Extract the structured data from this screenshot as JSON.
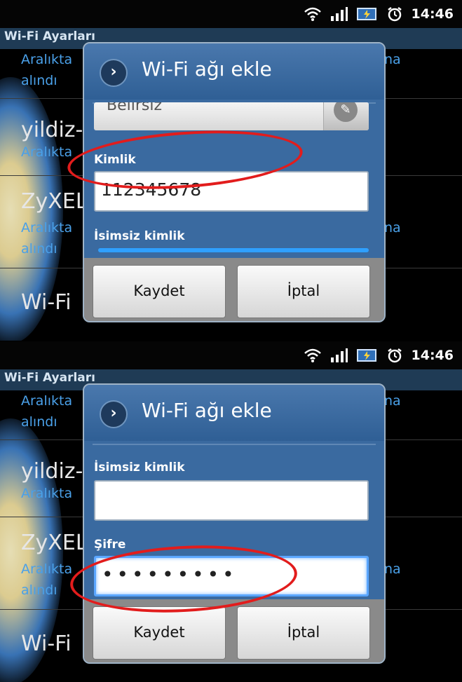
{
  "status_bar": {
    "time": "14:46",
    "icons": [
      "wifi-icon",
      "signal-icon",
      "battery-icon",
      "alarm-icon"
    ]
  },
  "app": {
    "title": "Wi-Fi Ayarları"
  },
  "background_list": {
    "item1_sub": "Aralıkta",
    "item1_sub2": "alındı",
    "item1_sub_suffix": "na",
    "item2_name": "yildiz-",
    "item2_sub": "Aralıkta",
    "item3_name": "ZyXEL",
    "item3_sub": "Aralıkta",
    "item3_sub2": "alındı",
    "item3_sub_suffix": "na",
    "item4_name": "Wi-Fi"
  },
  "screen1": {
    "dialog_title": "Wi-Fi ağı ekle",
    "select_value": "Belirsiz",
    "identity_label": "Kimlik",
    "identity_value": "112345678",
    "anon_identity_label": "İsimsiz kimlik",
    "save_label": "Kaydet",
    "cancel_label": "İptal"
  },
  "screen2": {
    "dialog_title": "Wi-Fi ağı ekle",
    "anon_identity_label": "İsimsiz kimlik",
    "anon_identity_value": "",
    "password_label": "Şifre",
    "password_value": "•••••••••",
    "save_label": "Kaydet",
    "cancel_label": "İptal"
  },
  "colors": {
    "annotation": "#e21c1c",
    "dialog_bg": "#3a6aa0",
    "focus": "#5aa6ff"
  }
}
